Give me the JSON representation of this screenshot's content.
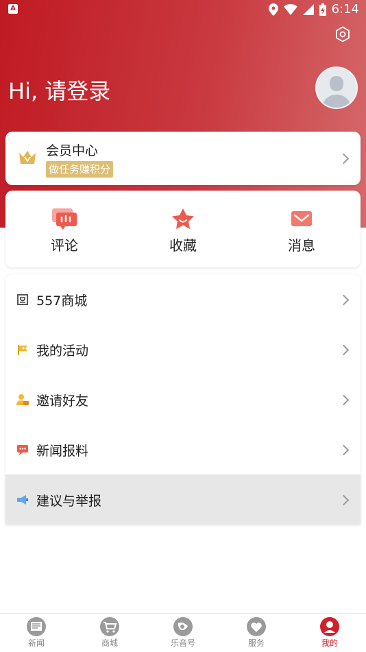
{
  "status_bar": {
    "time": "6:14",
    "app_icon_letter": "A"
  },
  "header": {
    "greeting": "Hi, 请登录",
    "background_color": "#c01a23"
  },
  "member_card": {
    "title": "会员中心",
    "badge": "做任务赚积分",
    "badge_color": "#dcbf74"
  },
  "quick_actions": [
    {
      "label": "评论",
      "icon": "comment-icon"
    },
    {
      "label": "收藏",
      "icon": "star-icon"
    },
    {
      "label": "消息",
      "icon": "mail-icon"
    }
  ],
  "menu": [
    {
      "label": "557商城",
      "icon": "shop-icon"
    },
    {
      "label": "我的活动",
      "icon": "flag-icon"
    },
    {
      "label": "邀请好友",
      "icon": "invite-icon"
    },
    {
      "label": "新闻报料",
      "icon": "report-icon"
    },
    {
      "label": "建议与举报",
      "icon": "suggest-icon",
      "pressed": true
    }
  ],
  "tab_bar": {
    "active_color": "#d0202c",
    "tabs": [
      {
        "label": "新闻",
        "icon": "news-icon"
      },
      {
        "label": "商城",
        "icon": "cart-icon"
      },
      {
        "label": "乐音号",
        "icon": "music-icon"
      },
      {
        "label": "服务",
        "icon": "service-icon"
      },
      {
        "label": "我的",
        "icon": "profile-icon",
        "active": true
      }
    ]
  }
}
